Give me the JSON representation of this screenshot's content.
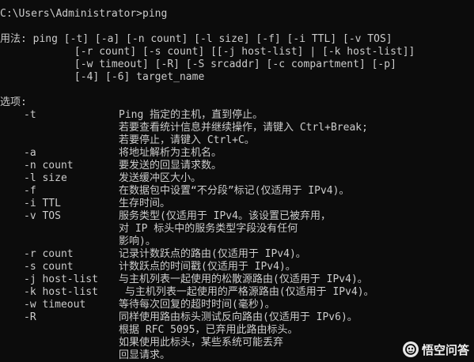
{
  "prompt_line": "C:\\Users\\Administrator>ping",
  "usage": [
    "用法: ping [-t] [-a] [-n count] [-l size] [-f] [-i TTL] [-v TOS]",
    "            [-r count] [-s count] [[-j host-list] | [-k host-list]]",
    "            [-w timeout] [-R] [-S srcaddr] [-c compartment] [-p]",
    "            [-4] [-6] target_name"
  ],
  "options_heading": "选项:",
  "options": [
    {
      "flag": "-t",
      "desc": "Ping 指定的主机，直到停止。"
    },
    {
      "flag": "",
      "desc": "若要查看统计信息并继续操作，请键入 Ctrl+Break;"
    },
    {
      "flag": "",
      "desc": "若要停止，请键入 Ctrl+C。"
    },
    {
      "flag": "-a",
      "desc": "将地址解析为主机名。"
    },
    {
      "flag": "-n count",
      "desc": "要发送的回显请求数。"
    },
    {
      "flag": "-l size",
      "desc": "发送缓冲区大小。"
    },
    {
      "flag": "-f",
      "desc": "在数据包中设置“不分段”标记(仅适用于 IPv4)。"
    },
    {
      "flag": "-i TTL",
      "desc": "生存时间。"
    },
    {
      "flag": "-v TOS",
      "desc": "服务类型(仅适用于 IPv4。该设置已被弃用，"
    },
    {
      "flag": "",
      "desc": "对 IP 标头中的服务类型字段没有任何"
    },
    {
      "flag": "",
      "desc": "影响)。"
    },
    {
      "flag": "-r count",
      "desc": "记录计数跃点的路由(仅适用于 IPv4)。"
    },
    {
      "flag": "-s count",
      "desc": "计数跃点的时间戳(仅适用于 IPv4)。"
    },
    {
      "flag": "-j host-list",
      "desc": "与主机列表一起使用的松散源路由(仅适用于 IPv4)。"
    },
    {
      "flag": "-k host-list",
      "desc": " 与主机列表一起使用的严格源路由(仅适用于 IPv4)。"
    },
    {
      "flag": "-w timeout",
      "desc": "等待每次回复的超时时间(毫秒)。"
    },
    {
      "flag": "-R",
      "desc": "同样使用路由标头测试反向路由(仅适用于 IPv6)。"
    },
    {
      "flag": "",
      "desc": "根据 RFC 5095，已弃用此路由标头。"
    },
    {
      "flag": "",
      "desc": "如果使用此标头，某些系统可能丢弃"
    },
    {
      "flag": "",
      "desc": "回显请求。"
    }
  ],
  "watermark": {
    "text": "悟空问答",
    "icon": "wukong-logo-icon"
  }
}
